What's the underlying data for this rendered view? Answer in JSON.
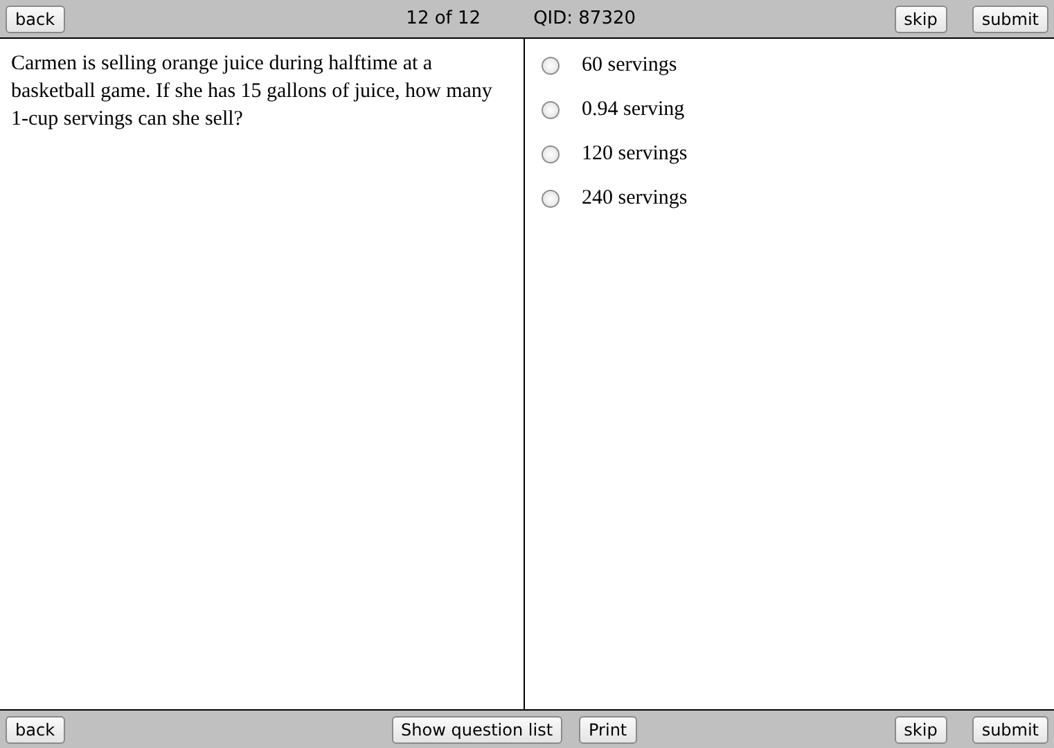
{
  "top_bar": {
    "back": "back",
    "counter": "12 of 12",
    "qid": "QID: 87320",
    "skip": "skip",
    "submit": "submit"
  },
  "question": "Carmen is selling orange juice during halftime at a basketball game. If she has 15 gallons of juice, how many 1-cup servings can she sell?",
  "options": [
    {
      "label": "60 servings",
      "selected": false
    },
    {
      "label": "0.94 serving",
      "selected": false
    },
    {
      "label": "120 servings",
      "selected": false
    },
    {
      "label": "240 servings",
      "selected": false
    }
  ],
  "bottom_bar": {
    "back": "back",
    "show_list": "Show question list",
    "print": "Print",
    "skip": "skip",
    "submit": "submit"
  }
}
